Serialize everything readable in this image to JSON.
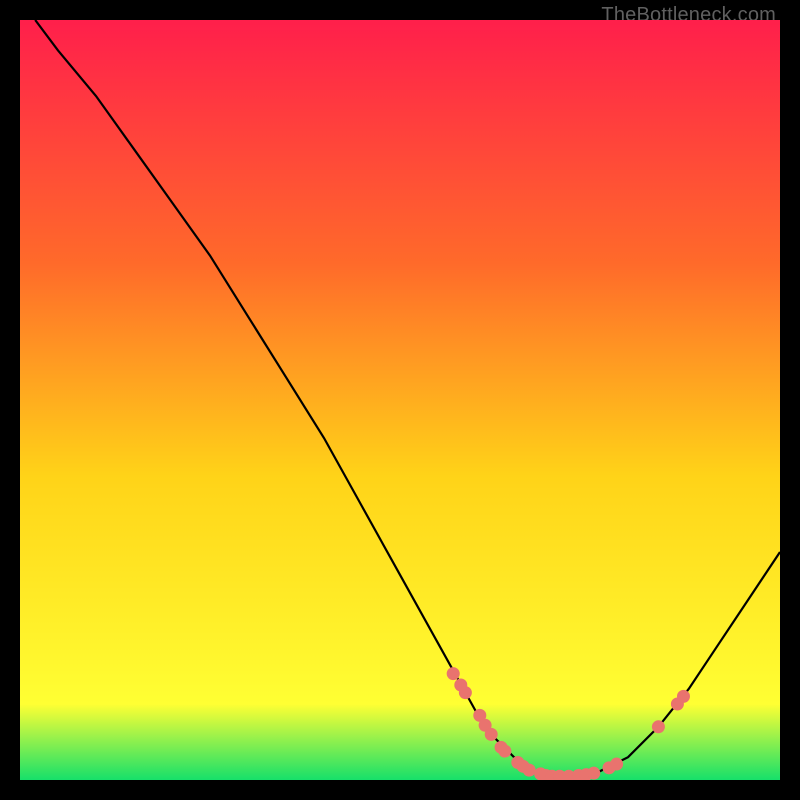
{
  "watermark": "TheBottleneck.com",
  "colors": {
    "gradient_top": "#ff1f4b",
    "gradient_mid1": "#ff6a2a",
    "gradient_mid2": "#ffd318",
    "gradient_mid3": "#ffff33",
    "gradient_bottom": "#16e06a",
    "curve": "#000000",
    "dot": "#e9736e",
    "bg": "#000000"
  },
  "chart_data": {
    "type": "line",
    "title": "",
    "xlabel": "",
    "ylabel": "",
    "xlim": [
      0,
      100
    ],
    "ylim": [
      0,
      100
    ],
    "x": [
      2,
      5,
      10,
      15,
      20,
      25,
      30,
      35,
      40,
      45,
      50,
      55,
      60,
      62,
      65,
      68,
      70,
      73,
      76,
      80,
      84,
      88,
      92,
      96,
      100
    ],
    "values": [
      100,
      96,
      90,
      83,
      76,
      69,
      61,
      53,
      45,
      36,
      27,
      18,
      9,
      6,
      3,
      1,
      0.5,
      0.5,
      1,
      3,
      7,
      12,
      18,
      24,
      30
    ],
    "series": [
      {
        "name": "bottleneck-curve",
        "x": [
          2,
          5,
          10,
          15,
          20,
          25,
          30,
          35,
          40,
          45,
          50,
          55,
          60,
          62,
          65,
          68,
          70,
          73,
          76,
          80,
          84,
          88,
          92,
          96,
          100
        ],
        "values": [
          100,
          96,
          90,
          83,
          76,
          69,
          61,
          53,
          45,
          36,
          27,
          18,
          9,
          6,
          3,
          1,
          0.5,
          0.5,
          1,
          3,
          7,
          12,
          18,
          24,
          30
        ]
      }
    ],
    "dots": [
      {
        "x": 57,
        "y": 14
      },
      {
        "x": 58,
        "y": 12.5
      },
      {
        "x": 58.6,
        "y": 11.5
      },
      {
        "x": 60.5,
        "y": 8.5
      },
      {
        "x": 61.2,
        "y": 7.2
      },
      {
        "x": 62,
        "y": 6
      },
      {
        "x": 63.3,
        "y": 4.3
      },
      {
        "x": 63.8,
        "y": 3.8
      },
      {
        "x": 65.5,
        "y": 2.3
      },
      {
        "x": 66.2,
        "y": 1.8
      },
      {
        "x": 67,
        "y": 1.3
      },
      {
        "x": 68.5,
        "y": 0.8
      },
      {
        "x": 69.2,
        "y": 0.6
      },
      {
        "x": 70,
        "y": 0.5
      },
      {
        "x": 71,
        "y": 0.5
      },
      {
        "x": 72.2,
        "y": 0.5
      },
      {
        "x": 73.5,
        "y": 0.6
      },
      {
        "x": 74.5,
        "y": 0.7
      },
      {
        "x": 75.5,
        "y": 0.9
      },
      {
        "x": 77.5,
        "y": 1.6
      },
      {
        "x": 78.5,
        "y": 2.1
      },
      {
        "x": 84,
        "y": 7
      },
      {
        "x": 86.5,
        "y": 10
      },
      {
        "x": 87.3,
        "y": 11
      }
    ]
  }
}
